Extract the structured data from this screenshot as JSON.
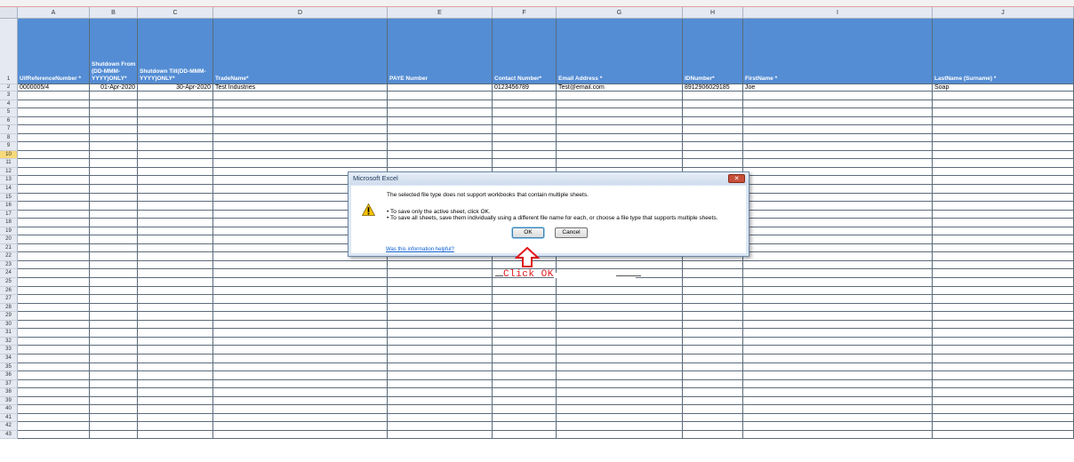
{
  "columns": [
    "A",
    "B",
    "C",
    "D",
    "E",
    "F",
    "G",
    "H",
    "I",
    "J"
  ],
  "headers": [
    "UifReferenceNumber *",
    "Shutdown From (DD-MMM-YYYY)ONLY*",
    "Shutdown Till(DD-MMM-YYYY)ONLY*",
    "TradeName*",
    "PAYE Number",
    "Contact Number*",
    "Email Address *",
    "IDNumber*",
    "FirstName *",
    "LastName (Surname) *"
  ],
  "data_row": [
    "0000005/4",
    "01-Apr-2020",
    "30-Apr-2020",
    "Test Industries",
    "",
    "0123456789",
    "Test@email.com",
    "8912906029185",
    "Joe",
    "Soap"
  ],
  "row_numbers": [
    "1",
    "2",
    "3",
    "4",
    "5",
    "6",
    "7",
    "8",
    "9",
    "10",
    "11",
    "12",
    "13",
    "14",
    "15",
    "16",
    "17",
    "18",
    "19",
    "20",
    "21",
    "22",
    "23",
    "24",
    "25",
    "26",
    "27",
    "28",
    "29",
    "30",
    "31",
    "32",
    "33",
    "34",
    "35",
    "36",
    "37",
    "38",
    "39",
    "40",
    "41",
    "42",
    "43"
  ],
  "selected_row": "10",
  "dialog": {
    "title": "Microsoft Excel",
    "message": "The selected file type does not support workbooks that contain multiple sheets.",
    "bullet1": "• To save only the active sheet, click OK.",
    "bullet2": "• To save all sheets, save them individually using a different file name for each, or choose a file type that supports multiple sheets.",
    "ok_label": "OK",
    "cancel_label": "Cancel",
    "help_link": "Was this information helpful?",
    "close_icon": "close-icon",
    "warning_icon": "warning-icon"
  },
  "annotation": {
    "text": "Click OK",
    "color": "#e0161c",
    "arrow_icon": "up-arrow-icon"
  },
  "colors": {
    "header_fill": "#548dd4",
    "header_text": "#ffffff",
    "selected_row": "#f7d97a"
  }
}
